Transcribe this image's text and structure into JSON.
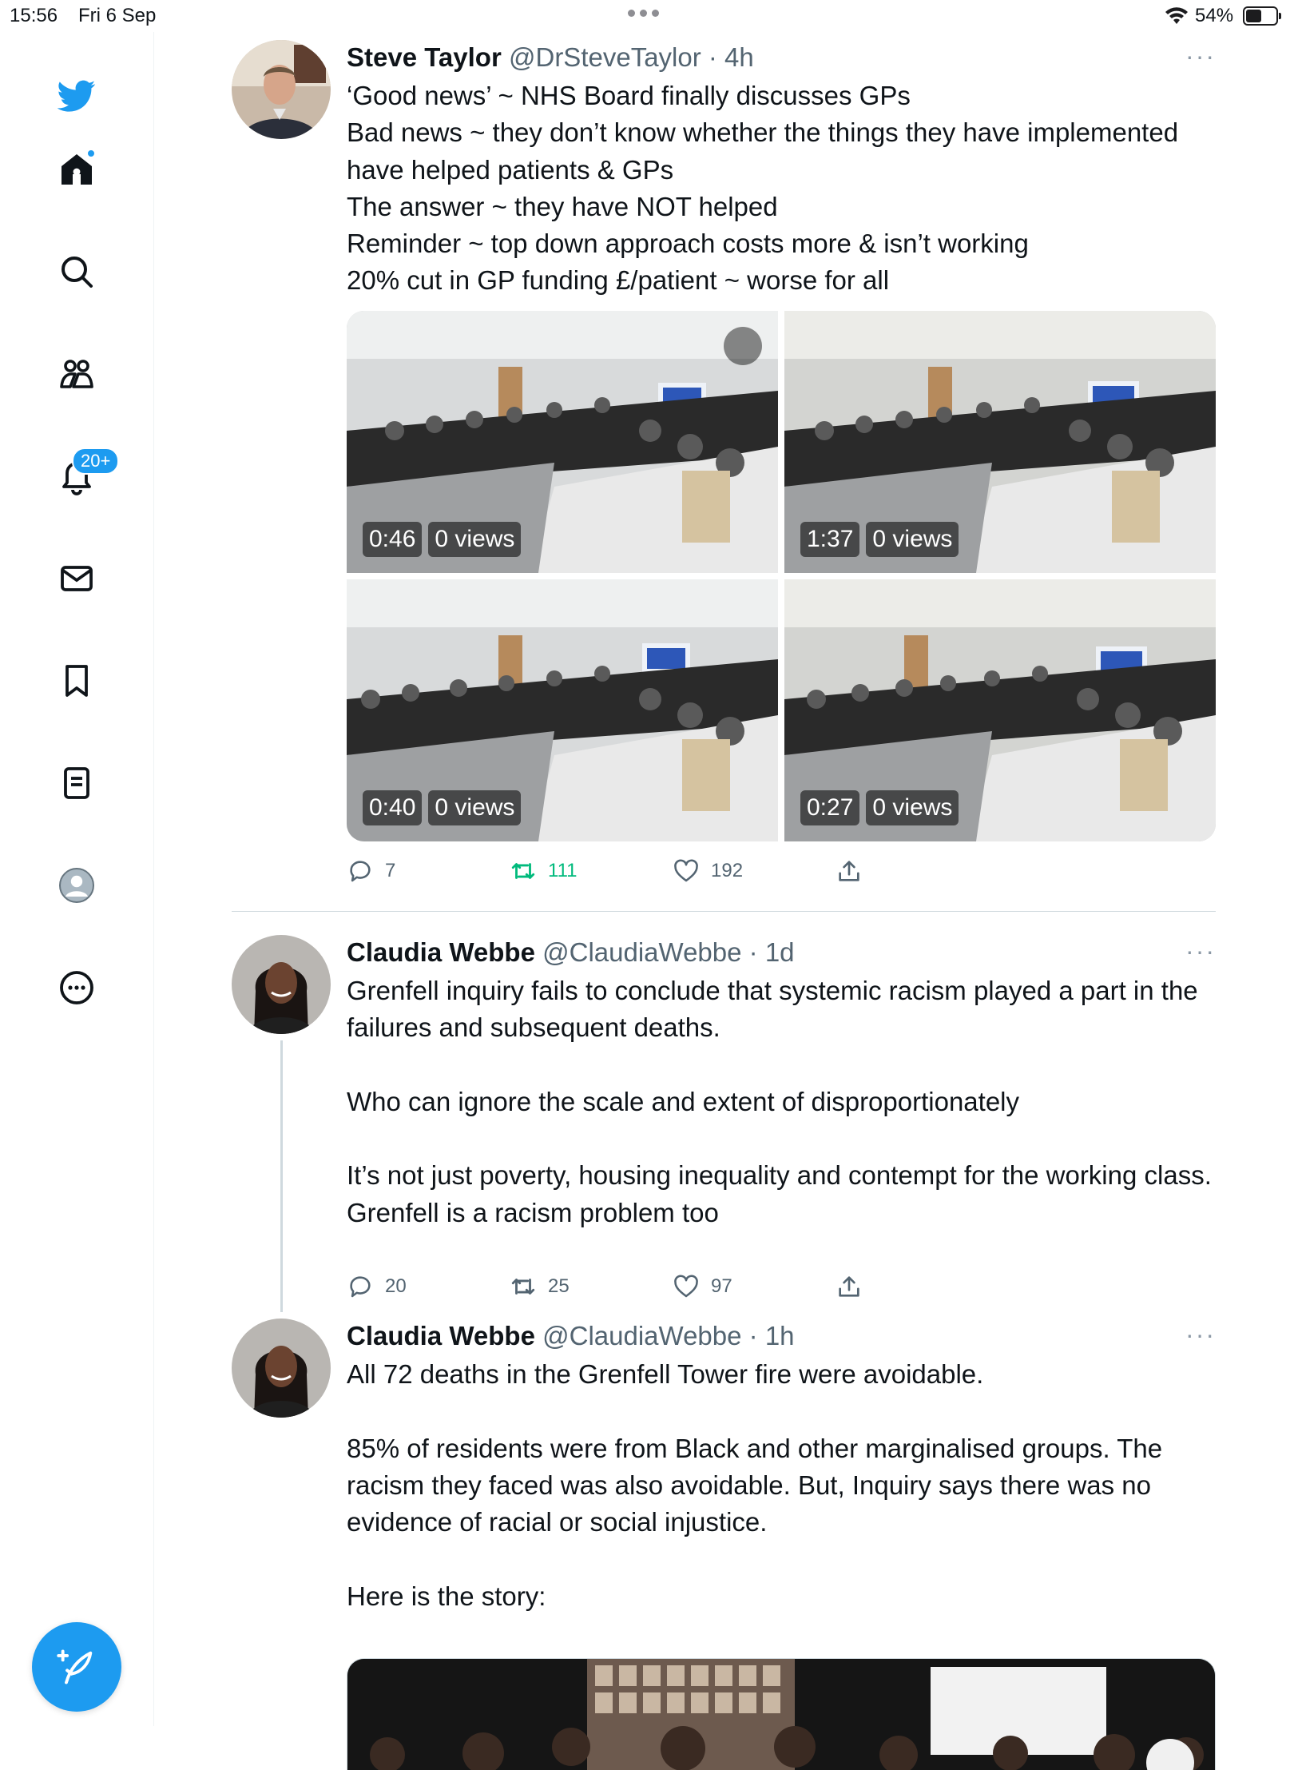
{
  "status_bar": {
    "time": "15:56",
    "date": "Fri 6 Sep",
    "battery": "54%",
    "battery_level": 0.54
  },
  "sidebar": {
    "notifications_badge": "20+"
  },
  "tweets": [
    {
      "name": "Steve Taylor",
      "handle": "@DrSteveTaylor",
      "time": "· 4h",
      "more": "···",
      "text": "‘Good news’ ~ NHS Board finally discusses GPs\nBad news ~ they don’t know whether the things they have implemented have helped patients & GPs\nThe answer ~ they have NOT helped\nReminder ~ top down approach costs more & isn’t working\n20% cut in GP funding £/patient ~ worse for all",
      "videos": [
        {
          "duration": "0:46",
          "views": "0 views"
        },
        {
          "duration": "1:37",
          "views": "0 views"
        },
        {
          "duration": "0:40",
          "views": "0 views"
        },
        {
          "duration": "0:27",
          "views": "0 views"
        }
      ],
      "replies": "7",
      "retweets": "111",
      "likes": "192"
    },
    {
      "name": "Claudia Webbe",
      "handle": "@ClaudiaWebbe",
      "time": "· 1d",
      "more": "···",
      "text": "Grenfell inquiry fails to conclude that systemic racism played a part in the failures and subsequent deaths.\n\nWho can ignore the scale and extent of disproportionately\n\nIt’s not just poverty, housing inequality and contempt for the working class. Grenfell is a racism problem too",
      "replies": "20",
      "retweets": "25",
      "likes": "97"
    },
    {
      "name": "Claudia Webbe",
      "handle": "@ClaudiaWebbe",
      "time": "· 1h",
      "more": "···",
      "text": "All 72 deaths in the Grenfell Tower fire were avoidable.\n\n85% of residents were from Black and other marginalised groups. The racism they faced was also avoidable. But, Inquiry says there was no evidence of racial or social injustice.\n\nHere is the story:"
    }
  ],
  "colors": {
    "accent": "#1d9bf0",
    "retweet_active": "#00ba7c",
    "secondary_text": "#536471"
  }
}
